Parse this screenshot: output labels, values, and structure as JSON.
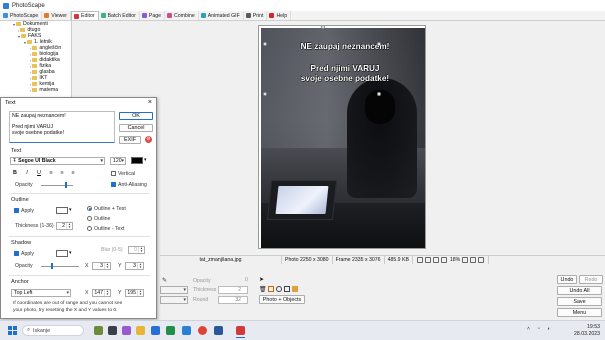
{
  "app": {
    "title": "PhotoScape"
  },
  "toolbar": {
    "tabs": [
      "PhotoScape",
      "Viewer",
      "Editor",
      "Batch Editor",
      "Page",
      "Combine",
      "Animated GIF",
      "Print",
      "Help"
    ],
    "active": "Editor"
  },
  "tree": {
    "items": [
      "Dokumenti",
      "dtugo",
      "FAKS",
      "1. letnik",
      "angleščin",
      "biologija",
      "didaktika",
      "fizika",
      "glasba",
      "IKT",
      "kemija",
      "matema"
    ]
  },
  "photo": {
    "overlay_line1": "NE zaupaj neznancem!",
    "overlay_line2": "Pred njimi VARUJ",
    "overlay_line3": "svoje osebne podatke!"
  },
  "status": {
    "filename": "tat_zmanjšana.jpg",
    "photo_size": "Photo 2250 x 3080",
    "frame_size": "Frame 2335 x 3076",
    "file_size": "485.9 KB",
    "zoom": "18%"
  },
  "bottom_panel": {
    "opacity_label": "Opacity",
    "opacity_value": "0",
    "thickness_label": "Thickness",
    "thickness_value": "2",
    "round_label": "Round",
    "round_value": "32",
    "photo_objects": "Photo + Objects",
    "undo": "Undo",
    "redo": "Redo",
    "undo_all": "Undo All",
    "save": "Save",
    "menu": "Menu"
  },
  "dialog": {
    "title": "Text",
    "text_lines": [
      "NE zaupaj neznancem!",
      "",
      "Pred njimi VARUJ",
      "svoje osebne podatke!"
    ],
    "ok": "OK",
    "cancel": "Cancel",
    "exif": "EXIF",
    "text_section": "Text",
    "font": "Segoe UI Black",
    "font_size": "120",
    "vertical": "Vertical",
    "anti_aliasing": "Anti-Aliasing",
    "opacity_label": "Opacity",
    "outline_section": "Outline",
    "apply_label": "Apply",
    "outline_text": "Outline + Text",
    "outline": "Outline",
    "outline_minus_text": "Outline - Text",
    "thickness_label": "Thickness (1-36)",
    "thickness_value": "2",
    "shadow_section": "Shadow",
    "shadow_apply": "Apply",
    "blur_label": "Blur (0-5)",
    "blur_value": "0",
    "shadow_opacity": "Opacity",
    "shadow_x_label": "X",
    "shadow_x": "3",
    "shadow_y_label": "Y",
    "shadow_y": "3",
    "anchor_section": "Anchor",
    "anchor": "Top Left",
    "anchor_x_label": "X",
    "anchor_x": "147",
    "anchor_y_label": "Y",
    "anchor_y": "195",
    "note_line1": "If coordinates are out of range and you cannot see",
    "note_line2": "your photo, try resetting the X and Y values to 0."
  },
  "taskbar": {
    "search": "Iskanje",
    "time": "19:53",
    "date": "28.03.2023"
  }
}
